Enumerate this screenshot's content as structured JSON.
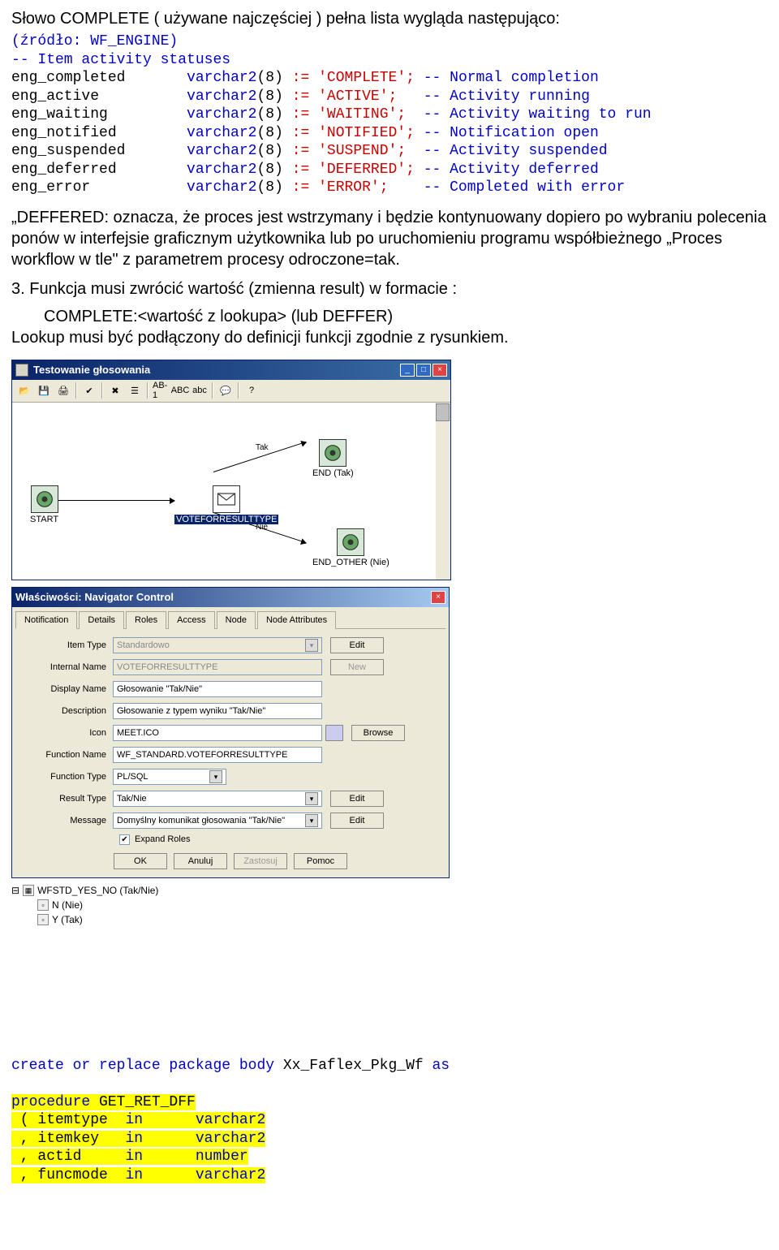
{
  "intro": {
    "line1": "Słowo COMPLETE ( używane najczęściej ) pełna lista wygląda następująco:",
    "line2": "(źródło: WF_ENGINE)",
    "cmt1": "-- Item activity statuses",
    "r1a": "eng_completed",
    "r1b": "varchar2",
    "r1c": ":= 'COMPLETE'; ",
    "r1d": "-- Normal completion",
    "r2a": "eng_active",
    "r2b": "varchar2",
    "r2c": ":= 'ACTIVE';   ",
    "r2d": "-- Activity running",
    "r3a": "eng_waiting",
    "r3b": "varchar2",
    "r3c": ":= 'WAITING';  ",
    "r3d": "-- Activity waiting to run",
    "r4a": "eng_notified",
    "r4b": "varchar2",
    "r4c": ":= 'NOTIFIED'; ",
    "r4d": "-- Notification open",
    "r5a": "eng_suspended",
    "r5b": "varchar2",
    "r5c": ":= 'SUSPEND';  ",
    "r5d": "-- Activity suspended",
    "r6a": "eng_deferred",
    "r6b": "varchar2",
    "r6c": ":= 'DEFERRED'; ",
    "r6d": "-- Activity deferred",
    "r7a": "eng_error",
    "r7b": "varchar2",
    "r7c": ":= 'ERROR';    ",
    "r7d": "-- Completed with error",
    "p8": "(8) "
  },
  "para1": "„DEFFERED: oznacza, że proces jest wstrzymany i będzie kontynuowany dopiero po wybraniu polecenia ponów w interfejsie graficznym użytkownika lub po uruchomieniu programu współbieżnego „Proces workflow w tle\" z parametrem procesy odroczone=tak.",
  "para2a": "3. Funkcja musi zwrócić wartość (zmienna result) w formacie :",
  "para2b": "COMPLETE:<wartość z lookupa> (lub DEFFER)",
  "para2c": "Lookup musi być podłączony do definicji funkcji zgodnie z rysunkiem.",
  "win": {
    "title": "Testowanie głosowania",
    "nodes": {
      "start": "START",
      "vote": "VOTEFORRESULTTYPE",
      "end": "END (Tak)",
      "endother": "END_OTHER (Nie)",
      "tak": "Tak",
      "nie": "Nie"
    },
    "toolbar": {
      "ab1": "AB-1",
      "abc": "ABC",
      "abc2": "abc"
    }
  },
  "dlg": {
    "title": "Właściwości: Navigator Control",
    "tabs": [
      "Notification",
      "Details",
      "Roles",
      "Access",
      "Node",
      "Node Attributes"
    ],
    "lbls": {
      "itemtype": "Item Type",
      "internal": "Internal Name",
      "display": "Display Name",
      "desc": "Description",
      "icon": "Icon",
      "fname": "Function Name",
      "ftype": "Function Type",
      "rtype": "Result Type",
      "msg": "Message",
      "expand": "Expand Roles"
    },
    "vals": {
      "itemtype": "Standardowo",
      "internal": "VOTEFORRESULTTYPE",
      "display": "Głosowanie \"Tak/Nie\"",
      "desc": "Głosowanie z typem wyniku \"Tak/Nie\"",
      "icon": "MEET.ICO",
      "fname": "WF_STANDARD.VOTEFORRESULTTYPE",
      "ftype": "PL/SQL",
      "rtype": "Tak/Nie",
      "msg": "Domyślny komunikat głosowania \"Tak/Nie\""
    },
    "btns": {
      "edit": "Edit",
      "new": "New",
      "browse": "Browse",
      "ok": "OK",
      "cancel": "Anuluj",
      "apply": "Zastosuj",
      "help": "Pomoc"
    }
  },
  "tree": {
    "n0": "WFSTD_YES_NO (Tak/Nie)",
    "n1": "N (Nie)",
    "n2": "Y (Tak)"
  },
  "bottom": {
    "create": "create or replace package body",
    "pkg": " Xx_Faflex_Pkg_Wf ",
    "as": "as",
    "proc": "procedure GET_RET_DFF",
    "p1": " ( itemtype  in      varchar2",
    "p2": " , itemkey   in      varchar2",
    "p3": " , actid     in      number",
    "p4": " , funcmode  in      varchar2"
  }
}
